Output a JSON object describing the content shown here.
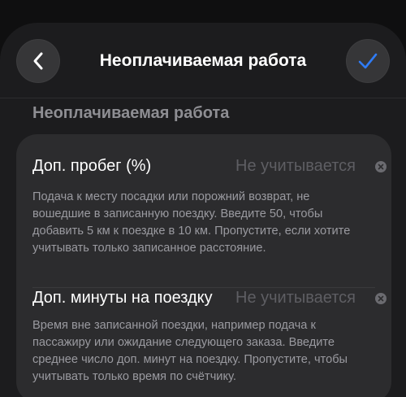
{
  "header": {
    "title": "Неоплачиваемая работа",
    "back_icon": "chevron-left-icon",
    "confirm_icon": "checkmark-icon",
    "accent_color": "#2f7cf6"
  },
  "section": {
    "title": "Неоплачиваемая работа"
  },
  "rows": [
    {
      "label": "Доп. пробег (%)",
      "placeholder": "Не учитывается",
      "value": "",
      "description": "Подача к месту посадки или порожний возврат, не вошедшие в записанную поездку. Введите 50, чтобы добавить 5 км к поездке в 10 км. Пропустите, если хотите учитывать только записанное расстояние."
    },
    {
      "label": "Доп. минуты на поездку",
      "placeholder": "Не учитывается",
      "value": "",
      "description": "Время вне записанной поездки, например подача к пассажиру или ожидание следующего заказа. Введите среднее число доп. минут на поездку. Пропустите, чтобы учитывать только время по счётчику."
    }
  ]
}
